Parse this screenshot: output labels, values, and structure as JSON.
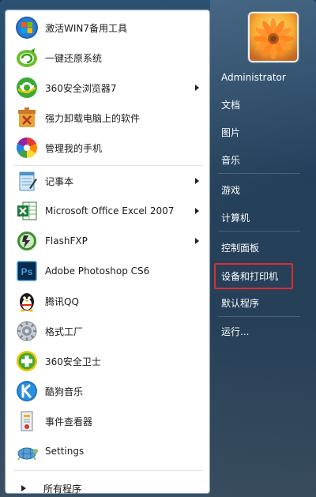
{
  "programs": [
    {
      "label": "激活WIN7备用工具",
      "icon": "win7-activation-icon",
      "has_submenu": false
    },
    {
      "label": "一键还原系统",
      "icon": "one-key-restore-icon",
      "has_submenu": false
    },
    {
      "label": "360安全浏览器7",
      "icon": "360-browser-icon",
      "has_submenu": true
    },
    {
      "label": "强力卸载电脑上的软件",
      "icon": "uninstaller-icon",
      "has_submenu": false
    },
    {
      "label": "管理我的手机",
      "icon": "phone-manager-icon",
      "has_submenu": false
    },
    {
      "label": "记事本",
      "icon": "notepad-icon",
      "has_submenu": true
    },
    {
      "label": "Microsoft Office Excel 2007",
      "icon": "excel-icon",
      "has_submenu": true
    },
    {
      "label": "FlashFXP",
      "icon": "flashfxp-icon",
      "has_submenu": true
    },
    {
      "label": "Adobe Photoshop CS6",
      "icon": "photoshop-icon",
      "has_submenu": false
    },
    {
      "label": "腾讯QQ",
      "icon": "qq-penguin-icon",
      "has_submenu": false
    },
    {
      "label": "格式工厂",
      "icon": "format-factory-icon",
      "has_submenu": false
    },
    {
      "label": "360安全卫士",
      "icon": "360-security-icon",
      "has_submenu": false
    },
    {
      "label": "酷狗音乐",
      "icon": "kugou-music-icon",
      "has_submenu": false
    },
    {
      "label": "事件查看器",
      "icon": "event-viewer-icon",
      "has_submenu": false
    },
    {
      "label": "Settings",
      "icon": "settings-turtle-icon",
      "has_submenu": false
    }
  ],
  "all_programs_label": "所有程序",
  "right_menu": [
    {
      "label": "Administrator"
    },
    {
      "label": "文档"
    },
    {
      "label": "图片"
    },
    {
      "label": "音乐"
    },
    {
      "label": "游戏"
    },
    {
      "label": "计算机"
    },
    {
      "label": "控制面板"
    },
    {
      "label": "设备和打印机"
    },
    {
      "label": "默认程序"
    },
    {
      "label": "运行..."
    }
  ],
  "highlighted_item": "设备和打印机",
  "colors": {
    "highlight_border": "#e02b2b",
    "menu_bg_top": "#2c5172",
    "menu_bg_bottom": "#3b4f62",
    "left_panel_bg": "#ffffff"
  }
}
